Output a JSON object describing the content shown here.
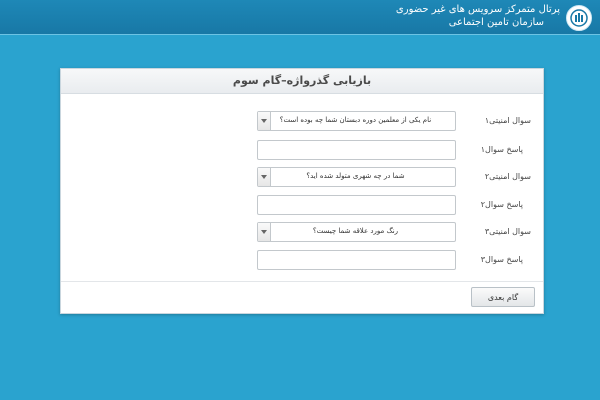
{
  "header": {
    "portal_title": "پرتال متمرکز سرویس های غیر حضوری",
    "org_name": "سازمان تامین اجتماعی",
    "logo_icon": "ssi-logo-icon"
  },
  "form": {
    "title": "بازیابی گذرواژه–گام سوم",
    "rows": [
      {
        "kind": "select",
        "label": "سوال امنیتی۱",
        "value": "نام یکی از معلمین دوره دبستان شما چه بوده است؟"
      },
      {
        "kind": "input",
        "label": "پاسخ سوال۱",
        "value": ""
      },
      {
        "kind": "select",
        "label": "سوال امنیتی۲",
        "value": "شما در چه شهری متولد شده اید؟"
      },
      {
        "kind": "input",
        "label": "پاسخ سوال۲",
        "value": ""
      },
      {
        "kind": "select",
        "label": "سوال امنیتی۳",
        "value": "رنگ مورد علاقه شما چیست؟"
      },
      {
        "kind": "input",
        "label": "پاسخ سوال۳",
        "value": ""
      }
    ],
    "next_label": "گام بعدی"
  },
  "colors": {
    "background": "#2aa3cf",
    "topbar": "#1e88b7",
    "panel": "#ffffff"
  }
}
